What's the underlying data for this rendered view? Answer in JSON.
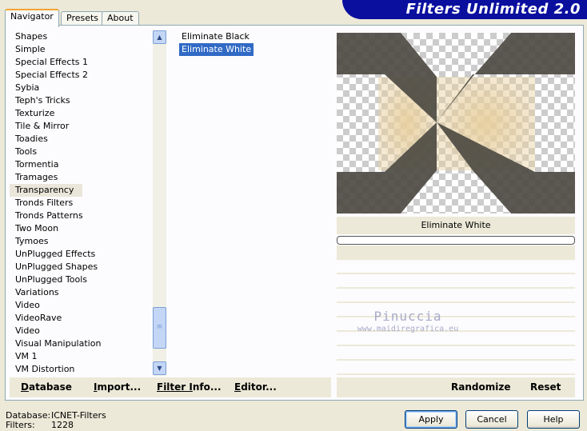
{
  "tabs": [
    {
      "label": "Navigator",
      "active": true
    },
    {
      "label": "Presets",
      "active": false
    },
    {
      "label": "About",
      "active": false
    }
  ],
  "brand": "Filters Unlimited 2.0",
  "categories": [
    "Shapes",
    "Simple",
    "Special Effects 1",
    "Special Effects 2",
    "Sybia",
    "Teph's Tricks",
    "Texturize",
    "Tile & Mirror",
    "Toadies",
    "Tools",
    "Tormentia",
    "Tramages",
    "Transparency",
    "Tronds Filters",
    "Tronds Patterns",
    "Two Moon",
    "Tymoes",
    "UnPlugged Effects",
    "UnPlugged Shapes",
    "UnPlugged Tools",
    "Variations",
    "Video",
    "VideoRave",
    "Video",
    "Visual Manipulation",
    "VM 1",
    "VM Distortion"
  ],
  "selected_category": "Transparency",
  "filters": [
    "Eliminate Black",
    "Eliminate White"
  ],
  "selected_filter": "Eliminate White",
  "preview": {
    "label": "Eliminate White",
    "dark_color": "#4e4b43",
    "light_color": "#e8cf9e",
    "progress": 0
  },
  "watermark": {
    "name": "Pinuccia",
    "url": "www.maidiregrafica.eu"
  },
  "left_buttons": [
    {
      "label": "Database",
      "underline": "D",
      "rest": "atabase"
    },
    {
      "label": "Import...",
      "underline": "I",
      "rest": "mport..."
    },
    {
      "label": "Filter Info...",
      "underline": "Filter I",
      "rest": "nfo..."
    },
    {
      "label": "Editor...",
      "underline": "E",
      "rest": "ditor..."
    }
  ],
  "right_buttons": [
    "Randomize",
    "Reset"
  ],
  "footer": {
    "database_label": "Database:",
    "database_value": "ICNET-Filters",
    "filters_label": "Filters:",
    "filters_value": "1228"
  },
  "dialog_buttons": [
    "Apply",
    "Cancel",
    "Help"
  ],
  "colors": {
    "selection": "#316ac5",
    "brand_bg": "#0a0f9e",
    "dialog_bg": "#ece9d8"
  }
}
